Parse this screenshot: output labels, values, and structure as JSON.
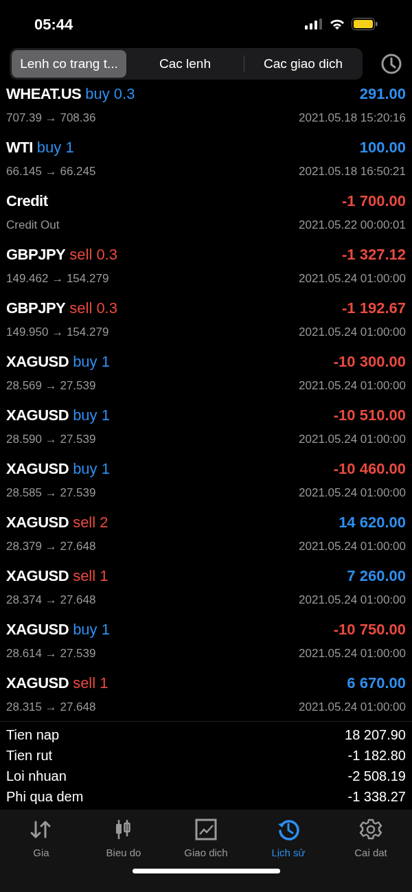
{
  "status_bar": {
    "time": "05:44"
  },
  "segments": [
    {
      "label": "Lenh co trang t...",
      "selected": true
    },
    {
      "label": "Cac lenh",
      "selected": false
    },
    {
      "label": "Cac giao dich",
      "selected": false
    }
  ],
  "rows": [
    {
      "kind": "trade",
      "symbol": "WHEAT.US",
      "type": "buy",
      "volume": "0.3",
      "prices": "707.39 → 708.36",
      "time": "2021.05.18 15:20:16",
      "profit": "291.00",
      "color": "#2f8ff0"
    },
    {
      "kind": "trade",
      "symbol": "WTI",
      "type": "buy",
      "volume": "1",
      "prices": "66.145 → 66.245",
      "time": "2021.05.18 16:50:21",
      "profit": "100.00",
      "color": "#2f8ff0"
    },
    {
      "kind": "balance",
      "symbol": "Credit",
      "comment": "Credit Out",
      "time": "2021.05.22 00:00:01",
      "profit": "-1 700.00",
      "color": "#ea4a3f"
    },
    {
      "kind": "trade",
      "symbol": "GBPJPY",
      "type": "sell",
      "volume": "0.3",
      "prices": "149.462 → 154.279",
      "time": "2021.05.24 01:00:00",
      "profit": "-1 327.12",
      "color": "#ea4a3f"
    },
    {
      "kind": "trade",
      "symbol": "GBPJPY",
      "type": "sell",
      "volume": "0.3",
      "prices": "149.950 → 154.279",
      "time": "2021.05.24 01:00:00",
      "profit": "-1 192.67",
      "color": "#ea4a3f"
    },
    {
      "kind": "trade",
      "symbol": "XAGUSD",
      "type": "buy",
      "volume": "1",
      "prices": "28.569 → 27.539",
      "time": "2021.05.24 01:00:00",
      "profit": "-10 300.00",
      "color": "#ea4a3f"
    },
    {
      "kind": "trade",
      "symbol": "XAGUSD",
      "type": "buy",
      "volume": "1",
      "prices": "28.590 → 27.539",
      "time": "2021.05.24 01:00:00",
      "profit": "-10 510.00",
      "color": "#ea4a3f"
    },
    {
      "kind": "trade",
      "symbol": "XAGUSD",
      "type": "buy",
      "volume": "1",
      "prices": "28.585 → 27.539",
      "time": "2021.05.24 01:00:00",
      "profit": "-10 460.00",
      "color": "#ea4a3f"
    },
    {
      "kind": "trade",
      "symbol": "XAGUSD",
      "type": "sell",
      "volume": "2",
      "prices": "28.379 → 27.648",
      "time": "2021.05.24 01:00:00",
      "profit": "14 620.00",
      "color": "#2f8ff0"
    },
    {
      "kind": "trade",
      "symbol": "XAGUSD",
      "type": "sell",
      "volume": "1",
      "prices": "28.374 → 27.648",
      "time": "2021.05.24 01:00:00",
      "profit": "7 260.00",
      "color": "#2f8ff0"
    },
    {
      "kind": "trade",
      "symbol": "XAGUSD",
      "type": "buy",
      "volume": "1",
      "prices": "28.614 → 27.539",
      "time": "2021.05.24 01:00:00",
      "profit": "-10 750.00",
      "color": "#ea4a3f"
    },
    {
      "kind": "trade",
      "symbol": "XAGUSD",
      "type": "sell",
      "volume": "1",
      "prices": "28.315 → 27.648",
      "time": "2021.05.24 01:00:00",
      "profit": "6 670.00",
      "color": "#2f8ff0"
    }
  ],
  "summary": [
    {
      "label": "Tien nap",
      "value": "18 207.90"
    },
    {
      "label": "Tien rut",
      "value": "-1 182.80"
    },
    {
      "label": "Loi nhuan",
      "value": "-2 508.19"
    },
    {
      "label": "Phi qua dem",
      "value": "-1 338.27"
    }
  ],
  "tab_bar": [
    {
      "label": "Gia",
      "kind": "quotes",
      "selected": false
    },
    {
      "label": "Bieu do",
      "kind": "chart",
      "selected": false
    },
    {
      "label": "Giao dich",
      "kind": "trade",
      "selected": false
    },
    {
      "label": "Lịch sử",
      "kind": "history",
      "selected": true
    },
    {
      "label": "Cai dat",
      "kind": "settings",
      "selected": false
    }
  ]
}
